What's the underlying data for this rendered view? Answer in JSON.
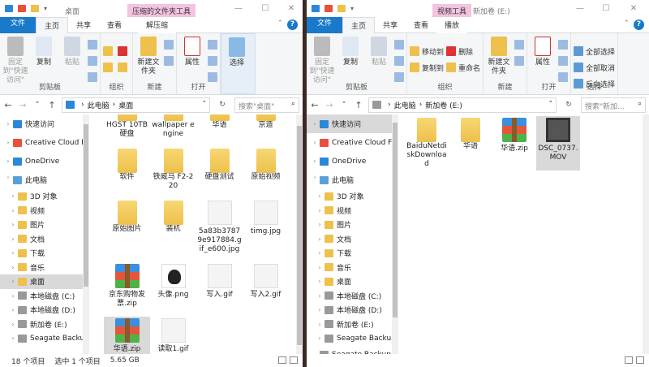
{
  "windows": [
    {
      "quick_access_icons": [
        "folder-icon",
        "properties-icon",
        "new-folder-icon",
        "dropdown-icon"
      ],
      "title": "桌面",
      "context_tab": "压缩的文件夹工具",
      "tabs": [
        "文件",
        "主页",
        "共享",
        "查看",
        "解压缩"
      ],
      "active_tab": 1,
      "ribbon_groups": [
        {
          "label": "剪贴板",
          "big": [
            "固定到\"快速访问\"",
            "复制",
            "粘贴"
          ],
          "small": [
            "cut",
            "copy-path",
            "paste-shortcut"
          ]
        },
        {
          "label": "组织",
          "big": [],
          "small_labeled": [
            "",
            "",
            "",
            ""
          ]
        },
        {
          "label": "新建",
          "big": [
            "新建文件夹"
          ],
          "small": [
            "new-item",
            "easy-access"
          ]
        },
        {
          "label": "打开",
          "big": [
            "属性"
          ],
          "small": [
            "open",
            "edit",
            "history"
          ]
        },
        {
          "label": "",
          "big": [
            "选择"
          ],
          "small": []
        }
      ],
      "address": {
        "path": [
          "此电脑",
          "桌面"
        ],
        "search_placeholder": "搜索\"桌面\""
      },
      "nav": [
        {
          "label": "快速访问",
          "level": 0,
          "icon": "star"
        },
        {
          "label": "Creative Cloud F",
          "level": 0,
          "icon": "cc"
        },
        {
          "label": "OneDrive",
          "level": 0,
          "icon": "cloud"
        },
        {
          "label": "此电脑",
          "level": 0,
          "icon": "pc",
          "expanded": true
        },
        {
          "label": "3D 对象",
          "level": 1,
          "icon": "folder"
        },
        {
          "label": "视频",
          "level": 1,
          "icon": "folder"
        },
        {
          "label": "图片",
          "level": 1,
          "icon": "folder"
        },
        {
          "label": "文档",
          "level": 1,
          "icon": "folder"
        },
        {
          "label": "下载",
          "level": 1,
          "icon": "folder"
        },
        {
          "label": "音乐",
          "level": 1,
          "icon": "folder"
        },
        {
          "label": "桌面",
          "level": 1,
          "icon": "folder",
          "selected": true
        },
        {
          "label": "本地磁盘 (C:)",
          "level": 1,
          "icon": "drive"
        },
        {
          "label": "本地磁盘 (D:)",
          "level": 1,
          "icon": "drive"
        },
        {
          "label": "新加卷 (E:)",
          "level": 1,
          "icon": "drive"
        },
        {
          "label": "Seagate Backup",
          "level": 1,
          "icon": "drive"
        }
      ],
      "files": [
        {
          "name": "HGST 10TB硬盘",
          "type": "folder"
        },
        {
          "name": "wallpaper engine",
          "type": "folder"
        },
        {
          "name": "华语",
          "type": "folder"
        },
        {
          "name": "京造",
          "type": "folder"
        },
        {
          "name": "软件",
          "type": "folder"
        },
        {
          "name": "铁威马 F2-220",
          "type": "folder"
        },
        {
          "name": "硬盘测试",
          "type": "folder"
        },
        {
          "name": "原始视频",
          "type": "folder"
        },
        {
          "name": "原始图片",
          "type": "folder"
        },
        {
          "name": "装机",
          "type": "folder"
        },
        {
          "name": "5a83b37879e917884.gif_e600.jpg",
          "type": "img"
        },
        {
          "name": "timg.jpg",
          "type": "img"
        },
        {
          "name": "京东购物发票.zip",
          "type": "zip"
        },
        {
          "name": "头像.png",
          "type": "cat"
        },
        {
          "name": "写入.gif",
          "type": "img"
        },
        {
          "name": "写入2.gif",
          "type": "img"
        },
        {
          "name": "华语.zip",
          "type": "zip",
          "selected": true
        },
        {
          "name": "读取1.gif",
          "type": "img"
        }
      ],
      "status": {
        "count": "18 个项目",
        "selected": "选中 1 个项目",
        "size": "5.65 GB"
      }
    },
    {
      "quick_access_icons": [
        "drive-icon",
        "properties-icon",
        "new-folder-icon",
        "dropdown-icon"
      ],
      "title": "新加卷 (E:)",
      "context_tab": "视频工具",
      "tabs": [
        "文件",
        "主页",
        "共享",
        "查看",
        "播放"
      ],
      "active_tab": 1,
      "ribbon_groups": [
        {
          "label": "剪贴板",
          "big": [
            "固定到\"快速访问\"",
            "复制",
            "粘贴"
          ],
          "small": [
            "cut",
            "copy-path",
            "paste-shortcut"
          ]
        },
        {
          "label": "组织",
          "big": [],
          "small_labeled": [
            "移动到",
            "复制到",
            "删除",
            "重命名"
          ]
        },
        {
          "label": "新建",
          "big": [
            "新建文件夹"
          ],
          "small": [
            "new-item",
            "easy-access"
          ]
        },
        {
          "label": "打开",
          "big": [
            "属性"
          ],
          "small": [
            "open",
            "edit",
            "history"
          ]
        },
        {
          "label": "选择",
          "big": [],
          "small_labeled": [
            "全部选择",
            "全部取消",
            "反向选择"
          ]
        }
      ],
      "address": {
        "path": [
          "此电脑",
          "新加卷 (E:)"
        ],
        "search_placeholder": "搜索\"新加..."
      },
      "nav": [
        {
          "label": "快速访问",
          "level": 0,
          "icon": "star",
          "selected": true
        },
        {
          "label": "Creative Cloud F",
          "level": 0,
          "icon": "cc"
        },
        {
          "label": "OneDrive",
          "level": 0,
          "icon": "cloud"
        },
        {
          "label": "此电脑",
          "level": 0,
          "icon": "pc",
          "expanded": true
        },
        {
          "label": "3D 对象",
          "level": 1,
          "icon": "folder"
        },
        {
          "label": "视频",
          "level": 1,
          "icon": "folder"
        },
        {
          "label": "图片",
          "level": 1,
          "icon": "folder"
        },
        {
          "label": "文档",
          "level": 1,
          "icon": "folder"
        },
        {
          "label": "下载",
          "level": 1,
          "icon": "folder"
        },
        {
          "label": "音乐",
          "level": 1,
          "icon": "folder"
        },
        {
          "label": "桌面",
          "level": 1,
          "icon": "folder"
        },
        {
          "label": "本地磁盘 (C:)",
          "level": 1,
          "icon": "drive"
        },
        {
          "label": "本地磁盘 (D:)",
          "level": 1,
          "icon": "drive"
        },
        {
          "label": "新加卷 (E:)",
          "level": 1,
          "icon": "drive"
        },
        {
          "label": "Seagate Backup",
          "level": 1,
          "icon": "drive"
        },
        {
          "label": "Seagate Backup",
          "level": 0,
          "icon": "drive"
        }
      ],
      "files": [
        {
          "name": "BaiduNetdiskDownload",
          "type": "folder"
        },
        {
          "name": "华语",
          "type": "folder"
        },
        {
          "name": "华语.zip",
          "type": "zip"
        },
        {
          "name": "DSC_0737.MOV",
          "type": "video",
          "selected": true
        }
      ],
      "status": {}
    }
  ],
  "colors": {
    "file_tab": "#1979ca",
    "context_tab": "#f4c3e0",
    "selection": "#d9d9d9",
    "folder": "#eec04c"
  }
}
